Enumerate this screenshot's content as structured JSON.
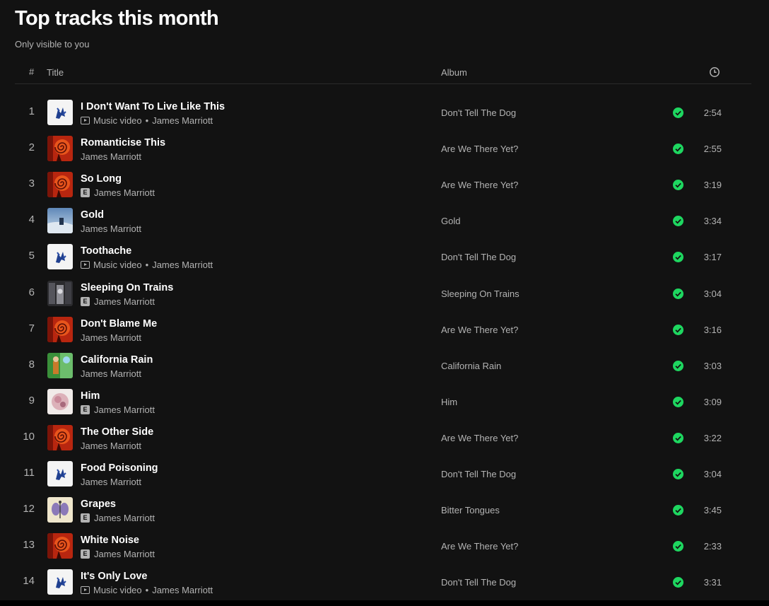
{
  "page": {
    "title": "Top tracks this month",
    "subtitle": "Only visible to you"
  },
  "header": {
    "number": "#",
    "title": "Title",
    "album": "Album",
    "duration_icon": "clock-icon"
  },
  "colors": {
    "background": "#121212",
    "text_primary": "#ffffff",
    "text_secondary": "#b3b3b3",
    "accent_green": "#1ed760"
  },
  "tracks": [
    {
      "number": "1",
      "title": "I Don't Want To Live Like This",
      "badge": "video",
      "badge_label": "Music video",
      "artist": "James Marriott",
      "album": "Don't Tell The Dog",
      "duration": "2:54",
      "saved": true,
      "art": "dog"
    },
    {
      "number": "2",
      "title": "Romanticise This",
      "badge": "",
      "artist": "James Marriott",
      "album": "Are We There Yet?",
      "duration": "2:55",
      "saved": true,
      "art": "spiral"
    },
    {
      "number": "3",
      "title": "So Long",
      "badge": "explicit",
      "badge_label": "E",
      "artist": "James Marriott",
      "album": "Are We There Yet?",
      "duration": "3:19",
      "saved": true,
      "art": "spiral"
    },
    {
      "number": "4",
      "title": "Gold",
      "badge": "",
      "artist": "James Marriott",
      "album": "Gold",
      "duration": "3:34",
      "saved": true,
      "art": "gold"
    },
    {
      "number": "5",
      "title": "Toothache",
      "badge": "video",
      "badge_label": "Music video",
      "artist": "James Marriott",
      "album": "Don't Tell The Dog",
      "duration": "3:17",
      "saved": true,
      "art": "dog"
    },
    {
      "number": "6",
      "title": "Sleeping On Trains",
      "badge": "explicit",
      "badge_label": "E",
      "artist": "James Marriott",
      "album": "Sleeping On Trains",
      "duration": "3:04",
      "saved": true,
      "art": "trains"
    },
    {
      "number": "7",
      "title": "Don't Blame Me",
      "badge": "",
      "artist": "James Marriott",
      "album": "Are We There Yet?",
      "duration": "3:16",
      "saved": true,
      "art": "spiral"
    },
    {
      "number": "8",
      "title": "California Rain",
      "badge": "",
      "artist": "James Marriott",
      "album": "California Rain",
      "duration": "3:03",
      "saved": true,
      "art": "california"
    },
    {
      "number": "9",
      "title": "Him",
      "badge": "explicit",
      "badge_label": "E",
      "artist": "James Marriott",
      "album": "Him",
      "duration": "3:09",
      "saved": true,
      "art": "him"
    },
    {
      "number": "10",
      "title": "The Other Side",
      "badge": "",
      "artist": "James Marriott",
      "album": "Are We There Yet?",
      "duration": "3:22",
      "saved": true,
      "art": "spiral"
    },
    {
      "number": "11",
      "title": "Food Poisoning",
      "badge": "",
      "artist": "James Marriott",
      "album": "Don't Tell The Dog",
      "duration": "3:04",
      "saved": true,
      "art": "dog"
    },
    {
      "number": "12",
      "title": "Grapes",
      "badge": "explicit",
      "badge_label": "E",
      "artist": "James Marriott",
      "album": "Bitter Tongues",
      "duration": "3:45",
      "saved": true,
      "art": "grapes"
    },
    {
      "number": "13",
      "title": "White Noise",
      "badge": "explicit",
      "badge_label": "E",
      "artist": "James Marriott",
      "album": "Are We There Yet?",
      "duration": "2:33",
      "saved": true,
      "art": "spiral"
    },
    {
      "number": "14",
      "title": "It's Only Love",
      "badge": "video",
      "badge_label": "Music video",
      "artist": "James Marriott",
      "album": "Don't Tell The Dog",
      "duration": "3:31",
      "saved": true,
      "art": "dog"
    }
  ]
}
